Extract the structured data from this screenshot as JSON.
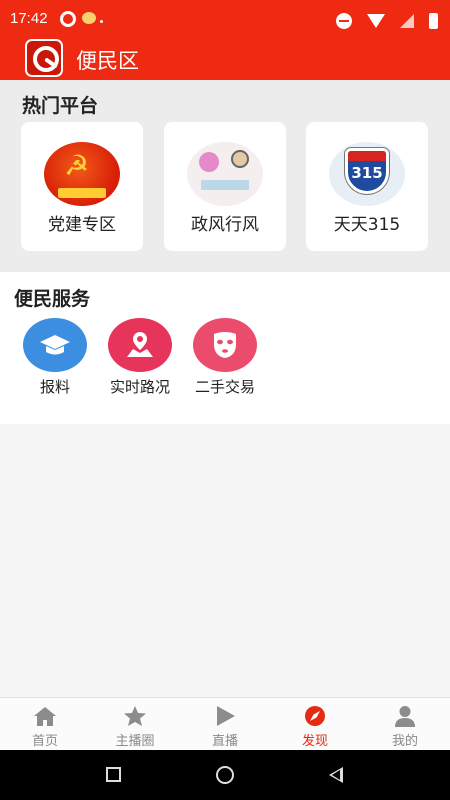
{
  "status_bar": {
    "time": "17:42"
  },
  "header": {
    "title": "便民区"
  },
  "hot_platform": {
    "title": "热门平台",
    "cards": [
      {
        "label": "党建专区",
        "icon": "party-emblem-icon",
        "badge": "红色党建"
      },
      {
        "label": "政风行风",
        "icon": "cartoon-service-icon"
      },
      {
        "label": "天天315",
        "icon": "interstate-shield-icon",
        "shield_number": "315",
        "shield_text": "INTERSTATE"
      }
    ]
  },
  "services": {
    "title": "便民服务",
    "items": [
      {
        "label": "报料",
        "icon": "graduation-cap-icon"
      },
      {
        "label": "实时路况",
        "icon": "map-pin-icon"
      },
      {
        "label": "二手交易",
        "icon": "mask-icon"
      }
    ]
  },
  "tabs": [
    {
      "label": "首页",
      "icon": "home-icon"
    },
    {
      "label": "主播圈",
      "icon": "star-icon"
    },
    {
      "label": "直播",
      "icon": "play-icon"
    },
    {
      "label": "发现",
      "icon": "compass-icon",
      "active": true
    },
    {
      "label": "我的",
      "icon": "user-icon"
    }
  ],
  "colors": {
    "brand": "#ee2a12",
    "active_tab": "#e62b12"
  }
}
